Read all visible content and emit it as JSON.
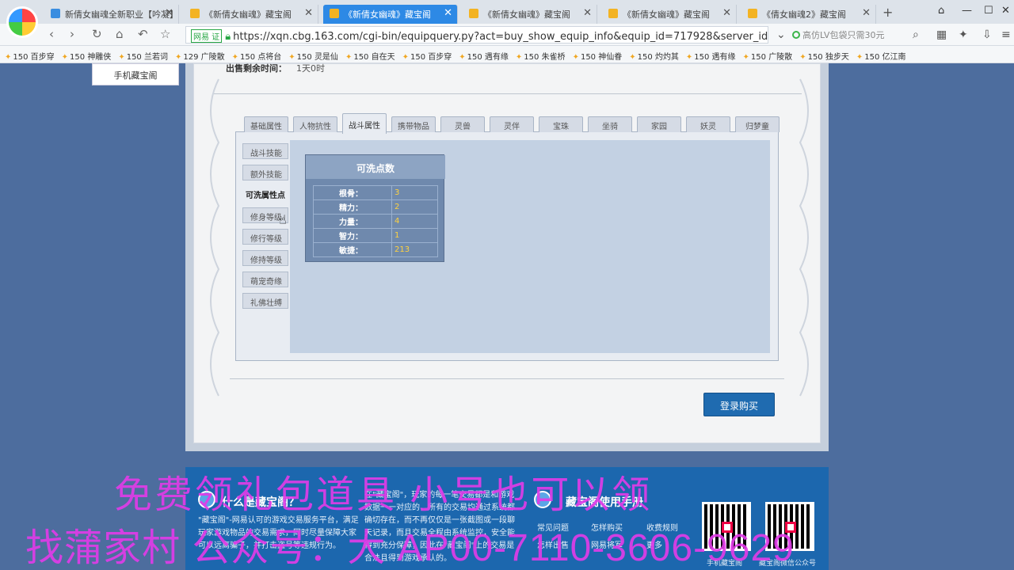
{
  "browser": {
    "tabs": [
      {
        "title": "新倩女幽魂全新职业【吟凝】",
        "active": false
      },
      {
        "title": "《新倩女幽魂》藏宝阁",
        "active": false
      },
      {
        "title": "《新倩女幽魂》藏宝阁",
        "active": true
      },
      {
        "title": "《新倩女幽魂》藏宝阁",
        "active": false
      },
      {
        "title": "《新倩女幽魂》藏宝阁",
        "active": false
      },
      {
        "title": "《倩女幽魂2》藏宝阁",
        "active": false
      }
    ],
    "url_badge": "网易 证",
    "url": "https://xqn.cbg.163.com/cgi-bin/equipquery.py?act=buy_show_equip_info&equip_id=717928&server_id=",
    "search_hint": "高仿LV包袋只需30元",
    "bookmarks": [
      "150 百步穿",
      "150 神雕侠",
      "150 兰若词",
      "129 广陵散",
      "150 点将台",
      "150 灵是仙",
      "150 自在天",
      "150 百步穿",
      "150 遇有缘",
      "150 朱雀桥",
      "150 神仙眷",
      "150 灼灼其",
      "150 遇有缘",
      "150 广陵散",
      "150 独步天",
      "150 亿江南"
    ]
  },
  "page": {
    "mobile_menu": "手机藏宝阁",
    "sale_time_label": "出售剩余时间：",
    "sale_time_value": "1天0时",
    "tabs": [
      "基础属性",
      "人物抗性",
      "战斗属性",
      "携带物品",
      "灵兽",
      "灵伴",
      "宝珠",
      "坐骑",
      "家园",
      "妖灵",
      "归梦童"
    ],
    "active_tab": "战斗属性",
    "side_buttons": [
      "战斗技能",
      "额外技能",
      "可洗属性点",
      "修身等级",
      "修行等级",
      "修持等级",
      "萌宠奇缘",
      "礼佛壮缚"
    ],
    "active_side": "可洗属性点",
    "points_box": {
      "title": "可洗点数",
      "rows": [
        {
          "key": "根骨：",
          "value": "3"
        },
        {
          "key": "精力：",
          "value": "2"
        },
        {
          "key": "力量：",
          "value": "4"
        },
        {
          "key": "智力：",
          "value": "1"
        },
        {
          "key": "敏捷：",
          "value": "213"
        }
      ]
    },
    "buy_button": "登录购买"
  },
  "footer": {
    "what_title": "什么是藏宝阁？",
    "what_text1": "\"藏宝阁\"-网易认可的游戏交易服务平台，满足玩家游戏物品的交易需求，同时尽量保障大家可以远离骗子，并打击盗号等违规行为。",
    "what_text2": "在\"藏宝阁\"，玩家的每一笔交易都是和游戏数据一一对应的，所有的交易均通过系统都确切存在，而不再仅仅是一张截图或一段聊天记录，而且交易全程由系统监控，安全能得到充分保障，因此在\"藏宝阁\"上的交易是合法且得到游戏承认的。",
    "manual_title": "藏宝阁使用手册",
    "links": [
      "常见问题",
      "怎样购买",
      "收费规则",
      "怎样出售",
      "网易将军",
      "更多"
    ],
    "qr1_label": "手机藏宝阁",
    "qr2_label": "藏宝阁微信公众号"
  },
  "watermark": {
    "line1": "免费领礼包道具 小号也可以领",
    "line2": "找蒲家村 公众号：大 AP00-7110-3606-9629"
  },
  "colors": {
    "accent": "#2d89e5",
    "buy_button": "#1f6bb0",
    "value_yellow": "#ffd23f",
    "watermark": "#e03ce8",
    "footer_bg": "#1c67ae"
  }
}
